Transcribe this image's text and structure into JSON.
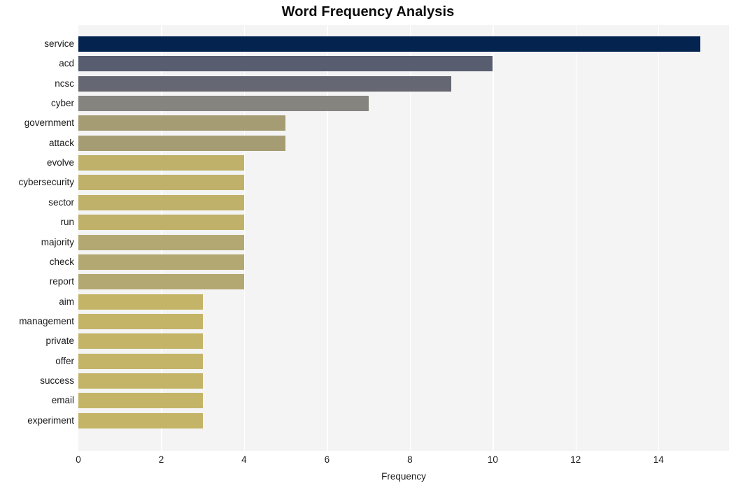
{
  "chart_data": {
    "type": "bar",
    "orientation": "horizontal",
    "title": "Word Frequency Analysis",
    "xlabel": "Frequency",
    "ylabel": "",
    "categories": [
      "service",
      "acd",
      "ncsc",
      "cyber",
      "government",
      "attack",
      "evolve",
      "cybersecurity",
      "sector",
      "run",
      "majority",
      "check",
      "report",
      "aim",
      "management",
      "private",
      "offer",
      "success",
      "email",
      "experiment"
    ],
    "values": [
      15,
      10,
      9,
      7,
      5,
      5,
      4,
      4,
      4,
      4,
      4,
      4,
      4,
      3,
      3,
      3,
      3,
      3,
      3,
      3
    ],
    "bar_colors": [
      "#04244f",
      "#585d70",
      "#656872",
      "#85847e",
      "#a69c74",
      "#a69c74",
      "#bfb169",
      "#bfb169",
      "#bfb169",
      "#bfb169",
      "#b3a871",
      "#b3a871",
      "#b3a871",
      "#c4b468",
      "#c4b468",
      "#c4b468",
      "#c4b468",
      "#c4b468",
      "#c4b468",
      "#c4b468"
    ],
    "xticks": [
      0,
      2,
      4,
      6,
      8,
      10,
      12,
      14
    ],
    "xlim": [
      0,
      15.7
    ],
    "grid": "vertical-white",
    "plot_background": "#f4f4f5",
    "figure_background": "#ffffff",
    "legend": "none"
  }
}
